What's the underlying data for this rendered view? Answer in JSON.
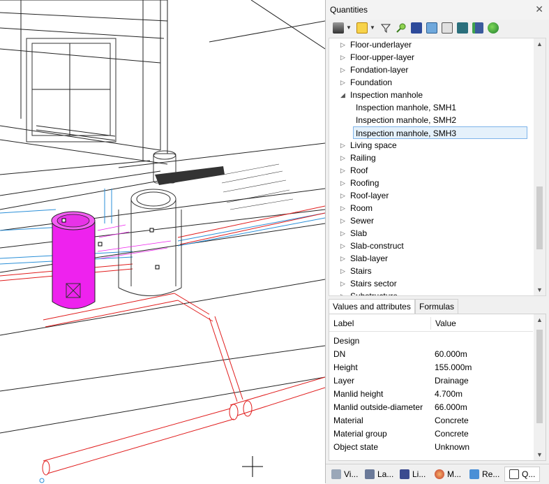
{
  "panel": {
    "title": "Quantities",
    "close_glyph": "✕",
    "toolbar_icons": [
      "layers-stack-icon",
      "quantity-report-icon",
      "filter-icon",
      "search-icon",
      "book-icon",
      "folder-icon",
      "copy-icon",
      "phone-book-icon",
      "export-icon",
      "globe-icon"
    ]
  },
  "tree": {
    "items": [
      {
        "label": "Floor-underlayer",
        "expanded": false
      },
      {
        "label": "Floor-upper-layer",
        "expanded": false
      },
      {
        "label": "Fondation-layer",
        "expanded": false
      },
      {
        "label": "Foundation",
        "expanded": false
      },
      {
        "label": "Inspection manhole",
        "expanded": true
      },
      {
        "label": "Inspection manhole, SMH1",
        "child": true
      },
      {
        "label": "Inspection manhole, SMH2",
        "child": true
      },
      {
        "label": "Inspection manhole, SMH3",
        "child": true,
        "selected": true
      },
      {
        "label": "Living space",
        "expanded": false
      },
      {
        "label": "Railing",
        "expanded": false
      },
      {
        "label": "Roof",
        "expanded": false
      },
      {
        "label": "Roofing",
        "expanded": false
      },
      {
        "label": "Roof-layer",
        "expanded": false
      },
      {
        "label": "Room",
        "expanded": false
      },
      {
        "label": "Sewer",
        "expanded": false
      },
      {
        "label": "Slab",
        "expanded": false
      },
      {
        "label": "Slab-construct",
        "expanded": false
      },
      {
        "label": "Slab-layer",
        "expanded": false
      },
      {
        "label": "Stairs",
        "expanded": false
      },
      {
        "label": "Stairs sector",
        "expanded": false
      },
      {
        "label": "Substructure",
        "expanded": false
      }
    ]
  },
  "tabs": [
    "Values and attributes",
    "Formulas"
  ],
  "grid": {
    "headers": {
      "label": "Label",
      "value": "Value"
    },
    "rows": [
      {
        "label": "Design",
        "value": ""
      },
      {
        "label": "DN",
        "value": "60.000m"
      },
      {
        "label": "Height",
        "value": "155.000m"
      },
      {
        "label": "Layer",
        "value": "Drainage"
      },
      {
        "label": "Manlid height",
        "value": "4.700m"
      },
      {
        "label": "Manlid outside-diameter",
        "value": "66.000m"
      },
      {
        "label": "Material",
        "value": "Concrete"
      },
      {
        "label": "Material group",
        "value": "Concrete"
      },
      {
        "label": "Object state",
        "value": "Unknown"
      }
    ]
  },
  "bottom_tabs": [
    {
      "label": "Vi...",
      "icon": "viewport-cube-icon"
    },
    {
      "label": "La...",
      "icon": "layers-icon"
    },
    {
      "label": "Li...",
      "icon": "library-icon"
    },
    {
      "label": "M...",
      "icon": "material-sphere-icon"
    },
    {
      "label": "Re...",
      "icon": "resources-icon"
    },
    {
      "label": "Q...",
      "icon": "quantities-icon",
      "active": true
    }
  ],
  "colors": {
    "selection_fill": "#e5f1fb",
    "selection_border": "#7eb4ea",
    "manhole_magenta": "#ee22ee",
    "pipe_red": "#e01c1c",
    "pipe_blue": "#2a8fd8"
  }
}
